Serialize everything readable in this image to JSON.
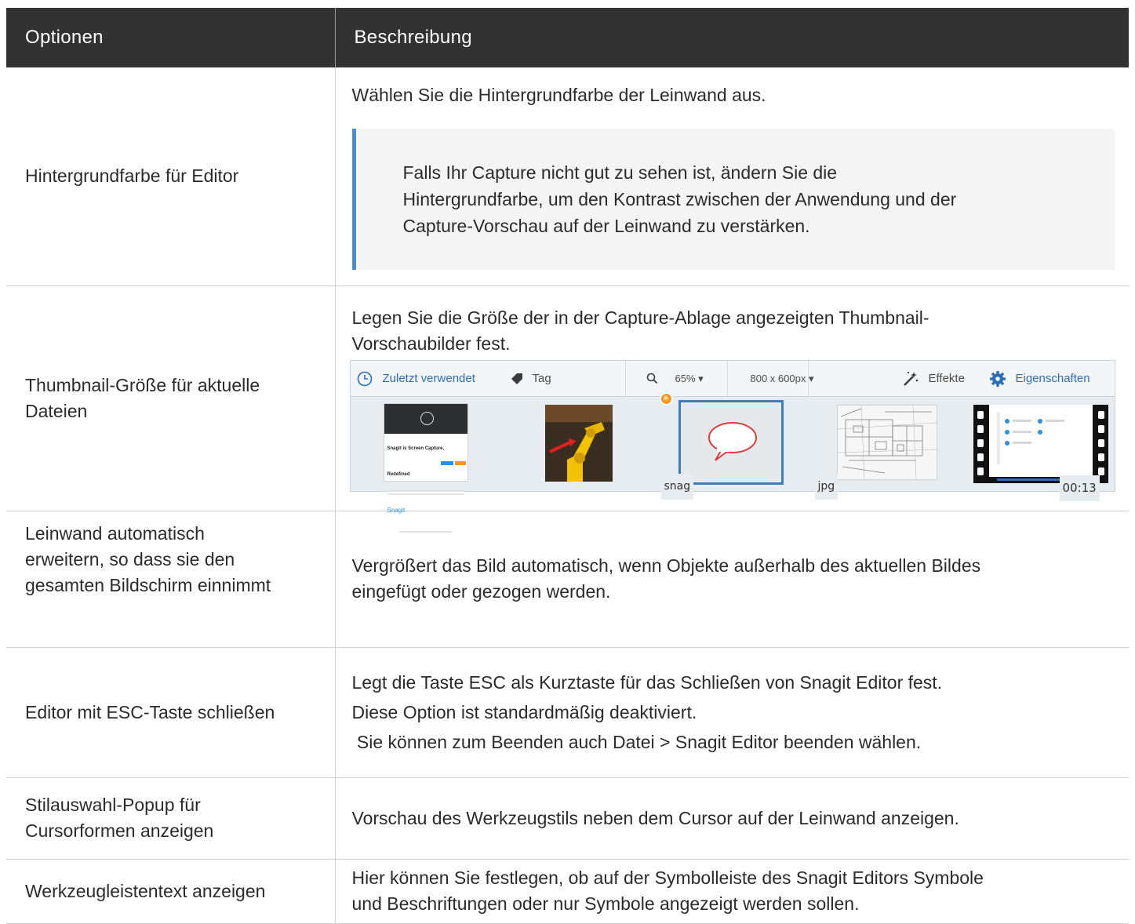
{
  "table": {
    "headers": {
      "options": "Optionen",
      "description": "Beschreibung"
    },
    "rows": [
      {
        "option": "Hintergrundfarbe für Editor",
        "description": "Wählen Sie die Hintergrundfarbe der Leinwand aus.",
        "note": [
          "Falls Ihr Capture nicht gut zu sehen ist, ändern Sie die",
          "Hintergrundfarbe, um den Kontrast zwischen der Anwendung und der",
          "Capture-Vorschau auf der Leinwand zu verstärken."
        ]
      },
      {
        "option": [
          "Thumbnail-Größe für aktuelle",
          "Dateien"
        ],
        "description": [
          "Legen Sie die Größe der in der Capture-Ablage angezeigten Thumbnail-",
          "Vorschaubilder fest."
        ],
        "tray": {
          "recent_label": "Zuletzt verwendet",
          "tag_label": "Tag",
          "zoom": "65%",
          "size": "800 x 600px",
          "effects_label": "Effekte",
          "properties_label": "Eigenschaften",
          "thumb_labels": {
            "snag": "snag",
            "jpg": "jpg",
            "duration": "00:13"
          },
          "thumb_web_title": "Snagit is Screen Capture, Redefined",
          "thumb_web_brand": "Snagit"
        }
      },
      {
        "option": [
          "Leinwand automatisch",
          "erweitern, so dass sie den",
          "gesamten Bildschirm einnimmt"
        ],
        "description": [
          "Vergrößert das Bild automatisch, wenn Objekte außerhalb des aktuellen Bildes",
          "eingefügt oder gezogen werden."
        ]
      },
      {
        "option": "Editor mit ESC-Taste schließen",
        "description": [
          "Legt die Taste ESC als Kurztaste für das Schließen von Snagit Editor fest.",
          "Diese Option ist standardmäßig deaktiviert.",
          " Sie können zum Beenden auch Datei > Snagit Editor beenden wählen."
        ]
      },
      {
        "option": [
          "Stilauswahl-Popup für",
          "Cursorformen anzeigen"
        ],
        "description": "Vorschau des Werkzeugstils neben dem Cursor auf der Leinwand anzeigen."
      },
      {
        "option": "Werkzeugleistentext anzeigen",
        "description": [
          "Hier können Sie festlegen, ob auf der Symbolleiste des Snagit Editors Symbole",
          "und Beschriftungen oder nur Symbole angezeigt werden sollen."
        ]
      }
    ]
  },
  "colors": {
    "header_bg": "#323232",
    "note_accent": "#4a90d0",
    "tray_accent": "#2d6db5"
  }
}
